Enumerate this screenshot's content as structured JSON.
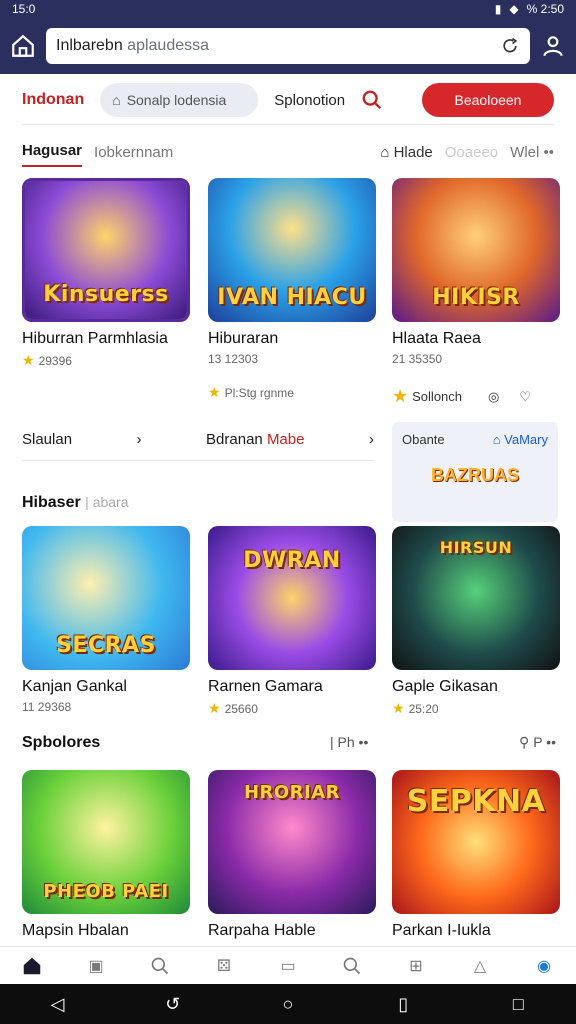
{
  "status_bar": {
    "time": "15:0",
    "right_text": "% 2:50"
  },
  "browser": {
    "url_primary": "Inlbarebn",
    "url_secondary": "aplaudessa"
  },
  "topnav": {
    "brand": "Indonan",
    "search_label": "Sonalp lodensia",
    "link": "Splonotion",
    "cta": "Beaoloeen"
  },
  "tabs": {
    "active": "Hagusar",
    "second": "Iobkernnam",
    "right_label_1": "Hlade",
    "right_label_2": "Ooaeeo",
    "right_label_3": "Wlel"
  },
  "row1": [
    {
      "title": "Hiburran Parmhlasia",
      "meta": "29396",
      "meta2": "",
      "word": "Kinsuerss",
      "theme": "purple"
    },
    {
      "title": "Hiburaran",
      "meta": "13 12303",
      "meta2": "Pl:Stg rgnme",
      "word": "IVAN HIACU",
      "theme": "blue"
    },
    {
      "title": "Hlaata Raea",
      "meta": "21 35350",
      "meta2": "Sollonch",
      "word": "HIKISR",
      "theme": "orange"
    }
  ],
  "row2_links": {
    "left": "Slaulan",
    "middle": "Bdranan",
    "middle_accent": "Mabe"
  },
  "promo": {
    "left": "Obante",
    "right": "VaMary",
    "word": "BAZRUAS"
  },
  "section1": {
    "title": "Hibaser",
    "sub": "abara"
  },
  "row3": [
    {
      "title": "Kanjan Gankal",
      "meta": "11 29368",
      "word": "SECRAS",
      "theme": "sky"
    },
    {
      "title": "Rarnen Gamara",
      "meta": "25660",
      "word": "DWRAN",
      "theme": "violet"
    },
    {
      "title": "Gaple Gikasan",
      "meta": "25:20",
      "word": "HIRSUN",
      "theme": "dark"
    }
  ],
  "section2": {
    "title": "Spbolores",
    "right1": "Ph",
    "right2": "P"
  },
  "row4": [
    {
      "title": "Mapsin Hbalan",
      "word": "PHEOB PAEI",
      "theme": "green"
    },
    {
      "title": "Rarpaha Hable",
      "word": "HRORIAR",
      "theme": "magenta"
    },
    {
      "title": "Parkan I-Iukla",
      "word": "SEPKNA",
      "theme": "fire"
    }
  ],
  "colors": {
    "header_bg": "#2b2f5e",
    "accent_red": "#d6272a",
    "brand_red": "#c4221f",
    "star": "#f1b500",
    "link_blue": "#1a5bd6"
  }
}
